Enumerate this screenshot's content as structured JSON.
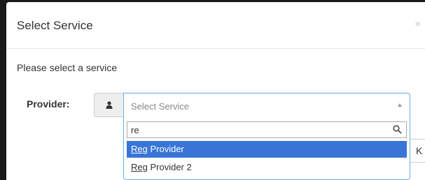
{
  "modal": {
    "title": "Select Service",
    "close_symbol": "×",
    "prompt": "Please select a service"
  },
  "form": {
    "provider_label": "Provider:",
    "addon_icon": "user-icon",
    "select": {
      "placeholder": "Select Service",
      "arrow_icon": "caret-up-icon"
    }
  },
  "dropdown": {
    "search_value": "re",
    "search_icon": "search-icon",
    "results": [
      {
        "match": "Reg",
        "rest": " Provider",
        "highlighted": true
      },
      {
        "match": "Reg",
        "rest": " Provider 2",
        "highlighted": false
      }
    ]
  },
  "partial_button": {
    "label_fragment": "K"
  },
  "colors": {
    "highlight": "#3875d7",
    "focus_border": "#66afe9",
    "backdrop": "#1a1a1a"
  }
}
